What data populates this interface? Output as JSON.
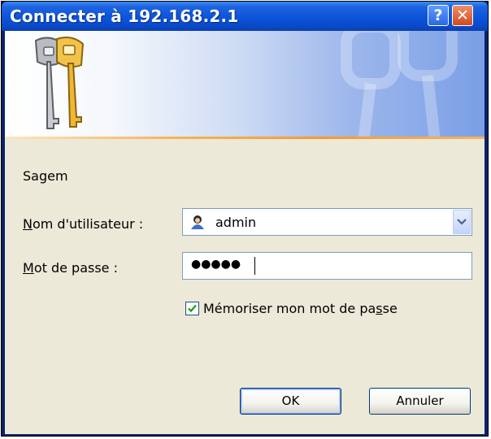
{
  "window": {
    "title": "Connecter à 192.168.2.1"
  },
  "titlebar": {
    "help_label": "?",
    "close_label": "✕"
  },
  "dialog": {
    "realm": "Sagem",
    "username": {
      "label_underlined": "N",
      "label_rest": "om d'utilisateur :",
      "value": "admin"
    },
    "password": {
      "label_underlined": "M",
      "label_rest": "ot de passe :",
      "value": "●●●●●"
    },
    "remember": {
      "label_before": "Mémoriser mon mot de pa",
      "label_underlined": "s",
      "label_after": "se",
      "checked": true
    }
  },
  "buttons": {
    "ok": "OK",
    "cancel": "Annuler"
  },
  "icons": {
    "banner": "keys-icon",
    "user": "user-icon",
    "dropdown": "chevron-down-icon",
    "check": "check-icon"
  }
}
